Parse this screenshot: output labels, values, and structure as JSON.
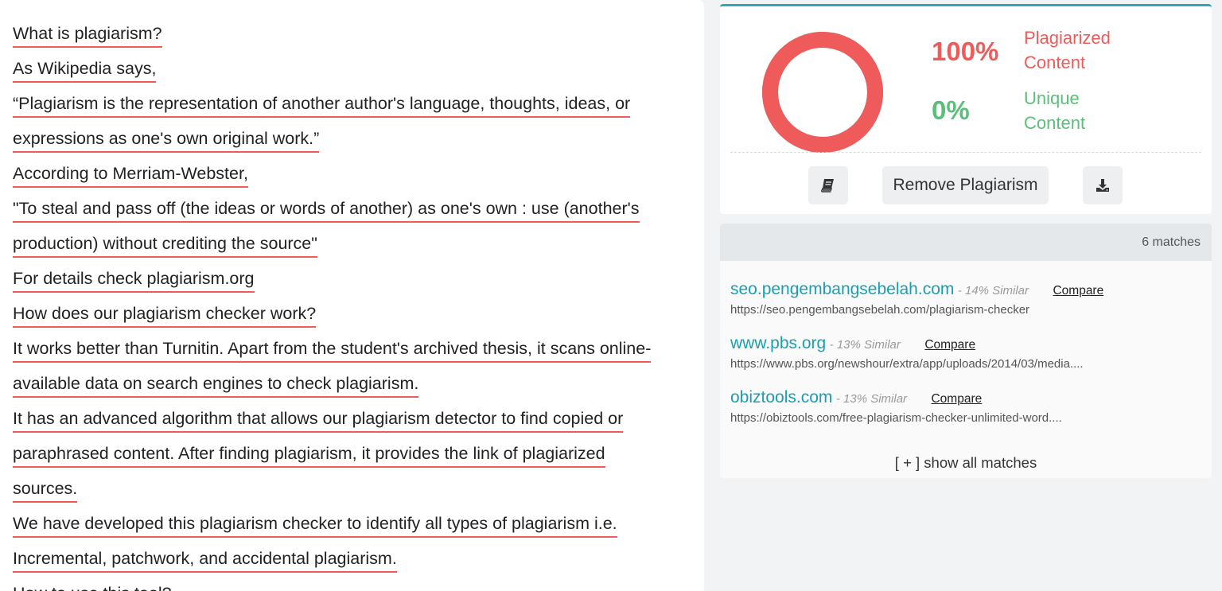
{
  "document": {
    "lines": [
      {
        "text": "What is plagiarism?",
        "highlighted": true
      },
      {
        "text": "As Wikipedia says,",
        "highlighted": true
      },
      {
        "text": "“Plagiarism is the representation of another author's language, thoughts, ideas, or",
        "highlighted": true
      },
      {
        "text": "expressions as one's own original work.”",
        "highlighted": true
      },
      {
        "text": "According to Merriam-Webster,",
        "highlighted": true
      },
      {
        "text": "\"To steal and pass off (the ideas or words of another) as one's own : use (another's",
        "highlighted": true
      },
      {
        "text": "production) without crediting the source\"",
        "highlighted": true
      },
      {
        "text": "For details check plagiarism.org",
        "highlighted": true
      },
      {
        "text": "How does our plagiarism checker work?",
        "highlighted": true
      },
      {
        "text": "It works better than Turnitin. Apart from the student's archived thesis, it scans online-",
        "highlighted": true
      },
      {
        "text": "available data on search engines to check plagiarism.",
        "highlighted": true
      },
      {
        "text": "It has an advanced algorithm that allows our plagiarism detector to find copied or",
        "highlighted": true
      },
      {
        "text": "paraphrased content. After finding plagiarism, it provides the link of plagiarized",
        "highlighted": true
      },
      {
        "text": "sources.",
        "highlighted": true
      },
      {
        "text": "We have developed this plagiarism checker to identify all types of plagiarism i.e.",
        "highlighted": true
      },
      {
        "text": "Incremental, patchwork, and accidental plagiarism.",
        "highlighted": true
      },
      {
        "text": "How to use this tool?",
        "highlighted": false
      }
    ]
  },
  "score": {
    "plagiarized_percent": "100%",
    "plagiarized_label": "Plagiarized Content",
    "unique_percent": "0%",
    "unique_label": "Unique Content",
    "plagiarized_fraction": 1.0,
    "colors": {
      "plagiarized": "#ef5b5b",
      "unique": "#5bbf7a",
      "accent": "#2ba9b5"
    }
  },
  "actions": {
    "book_icon": "book-icon",
    "remove_label": "Remove Plagiarism",
    "download_icon": "download-icon"
  },
  "matches": {
    "count_label": "6 matches",
    "items": [
      {
        "domain": "seo.pengembangsebelah.com",
        "similarity": "- 14% Similar",
        "compare": "Compare",
        "url": "https://seo.pengembangsebelah.com/plagiarism-checker"
      },
      {
        "domain": "www.pbs.org",
        "similarity": "- 13% Similar",
        "compare": "Compare",
        "url": "https://www.pbs.org/newshour/extra/app/uploads/2014/03/media...."
      },
      {
        "domain": "obiztools.com",
        "similarity": "- 13% Similar",
        "compare": "Compare",
        "url": "https://obiztools.com/free-plagiarism-checker-unlimited-word...."
      }
    ],
    "show_all_label": "[ + ] show all matches"
  }
}
